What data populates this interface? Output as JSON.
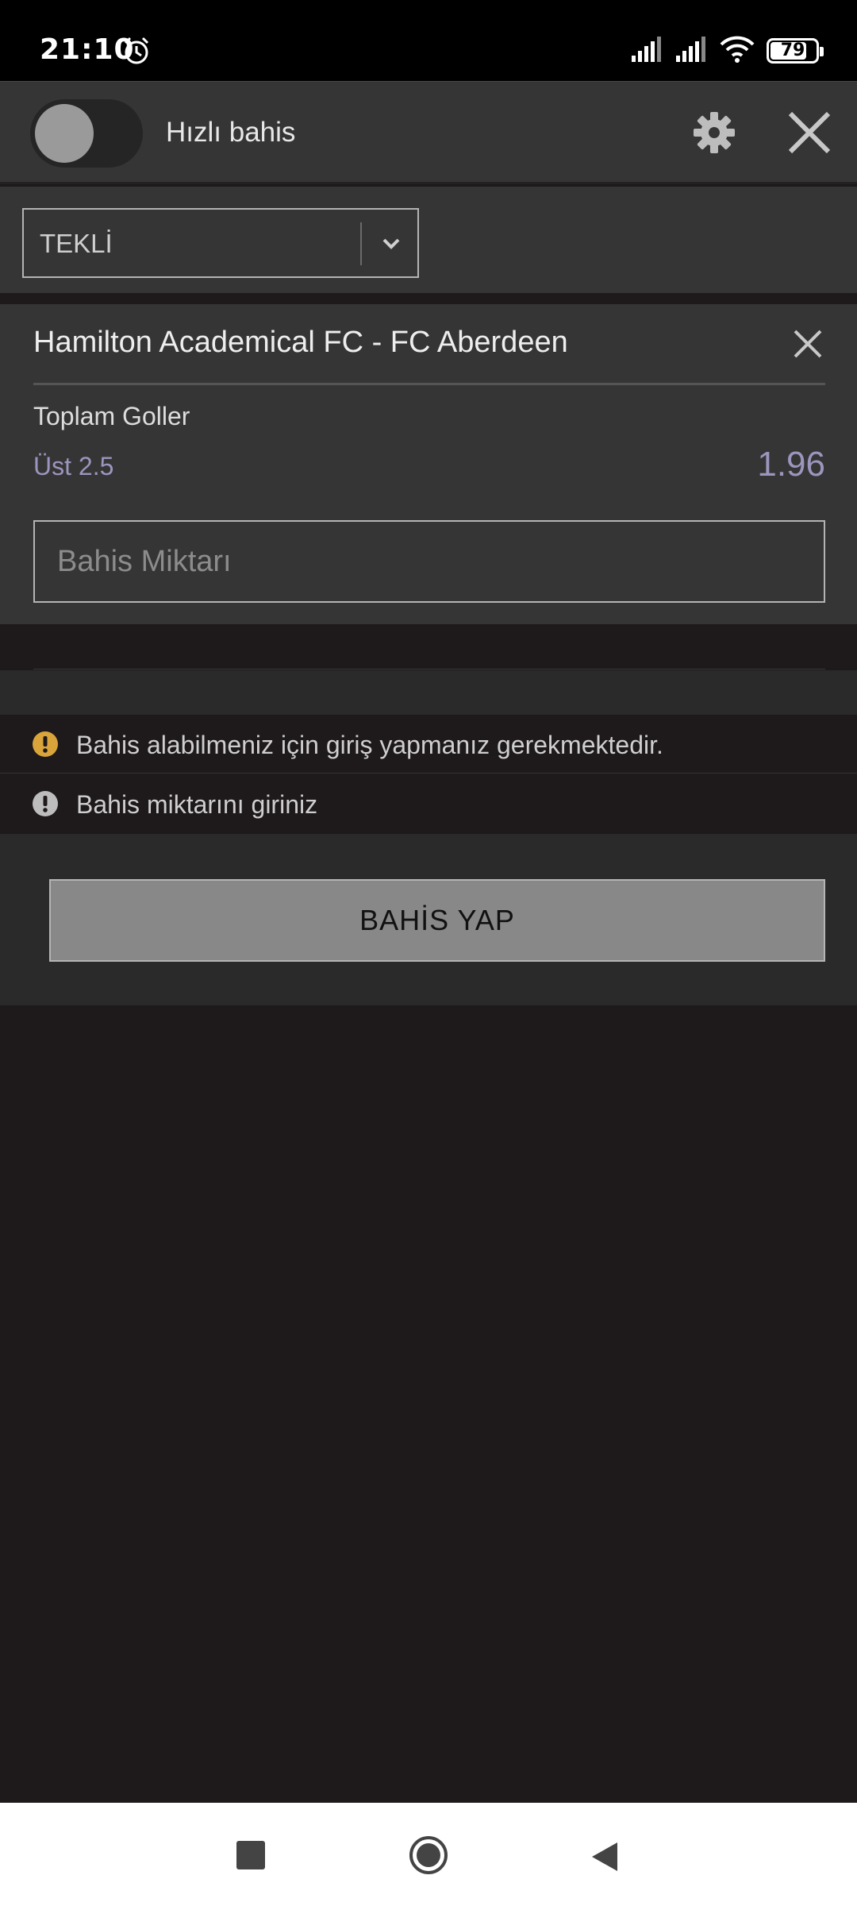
{
  "status_bar": {
    "time": "21:10",
    "battery": "79",
    "icons": [
      "alarm-icon",
      "signal-icon",
      "signal-icon",
      "wifi-icon",
      "battery-icon"
    ]
  },
  "quick_bet": {
    "label": "Hızlı bahis",
    "toggle_on": false,
    "icons": [
      "gear-icon",
      "close-icon"
    ]
  },
  "bet_type": {
    "selected": "TEKLİ",
    "icon": "chevron-down-icon"
  },
  "bet": {
    "match": "Hamilton Academical FC - FC Aberdeen",
    "market": "Toplam Goller",
    "selection": "Üst 2.5",
    "odds": "1.96",
    "stake_placeholder": "Bahis Miktarı"
  },
  "messages": [
    {
      "text": "Bahis alabilmeniz için giriş yapmanız gerekmektedir.",
      "icon": "warning-icon",
      "color": "#d9a53b"
    },
    {
      "text": "Bahis miktarını giriniz",
      "icon": "info-icon",
      "color": "#bdbdbd"
    }
  ],
  "actions": {
    "place_bet_label": "BAHİS YAP"
  },
  "colors": {
    "background": "#1e191a",
    "panel": "#363536",
    "odds": "#9d95bd",
    "button": "#888888"
  }
}
